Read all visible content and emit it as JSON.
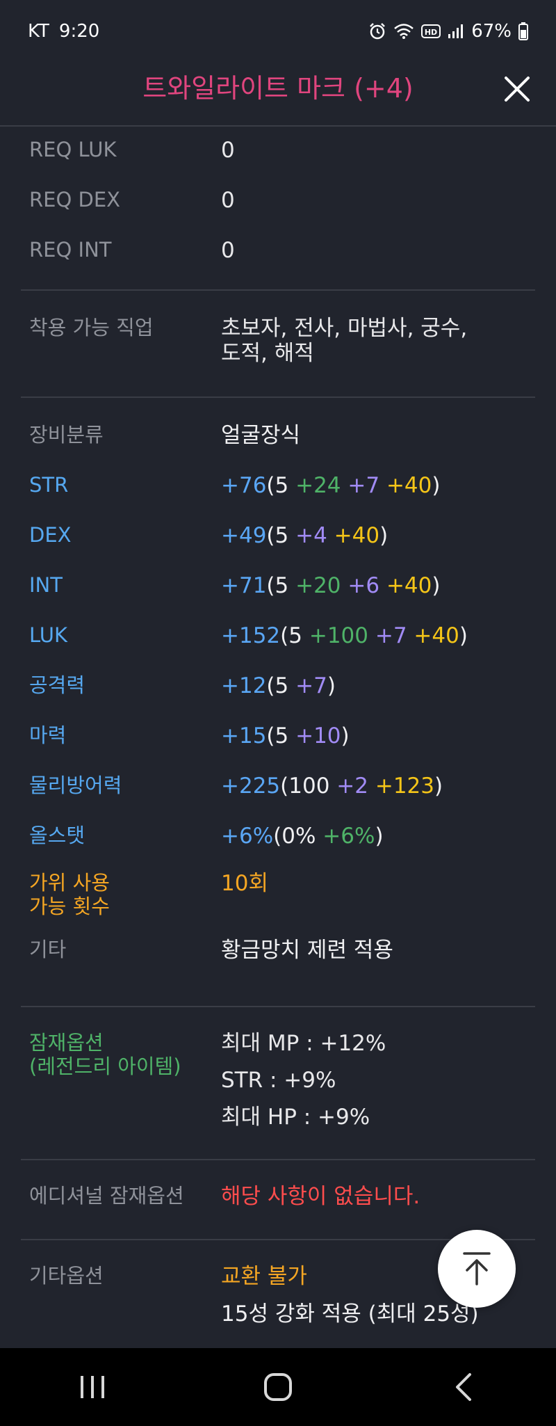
{
  "status_bar": {
    "carrier": "KT",
    "time": "9:20",
    "battery": "67%",
    "icons": [
      "alarm-icon",
      "wifi-icon",
      "hd-icon",
      "signal-icon",
      "battery-icon"
    ]
  },
  "header": {
    "title": "트와일라이트 마크 (+4)",
    "close_icon": "close-icon"
  },
  "requirements": [
    {
      "label": "REQ LUK",
      "value": "0"
    },
    {
      "label": "REQ DEX",
      "value": "0"
    },
    {
      "label": "REQ INT",
      "value": "0"
    }
  ],
  "jobs": {
    "label": "착용 가능 직업",
    "line1": "초보자, 전사, 마법사, 궁수,",
    "line2": "도적, 해적"
  },
  "category": {
    "label": "장비분류",
    "value": "얼굴장식"
  },
  "stats": [
    {
      "label": "STR",
      "total": "+76",
      "open": "(5",
      "parts": [
        {
          "text": " +24",
          "color": "green"
        },
        {
          "text": " +7",
          "color": "purple"
        },
        {
          "text": " +40",
          "color": "yellow"
        }
      ],
      "close": ")"
    },
    {
      "label": "DEX",
      "total": "+49",
      "open": "(5",
      "parts": [
        {
          "text": " +4",
          "color": "purple"
        },
        {
          "text": " +40",
          "color": "yellow"
        }
      ],
      "close": ")"
    },
    {
      "label": "INT",
      "total": "+71",
      "open": "(5",
      "parts": [
        {
          "text": " +20",
          "color": "green"
        },
        {
          "text": " +6",
          "color": "purple"
        },
        {
          "text": " +40",
          "color": "yellow"
        }
      ],
      "close": ")"
    },
    {
      "label": "LUK",
      "total": "+152",
      "open": "(5",
      "parts": [
        {
          "text": " +100",
          "color": "green"
        },
        {
          "text": " +7",
          "color": "purple"
        },
        {
          "text": " +40",
          "color": "yellow"
        }
      ],
      "close": ")"
    },
    {
      "label": "공격력",
      "total": "+12",
      "open": "(5",
      "parts": [
        {
          "text": " +7",
          "color": "purple"
        }
      ],
      "close": ")"
    },
    {
      "label": "마력",
      "total": "+15",
      "open": "(5",
      "parts": [
        {
          "text": " +10",
          "color": "purple"
        }
      ],
      "close": ")"
    },
    {
      "label": "물리방어력",
      "total": "+225",
      "open": "(100",
      "parts": [
        {
          "text": " +2",
          "color": "purple"
        },
        {
          "text": " +123",
          "color": "yellow"
        }
      ],
      "close": ")"
    },
    {
      "label": "올스탯",
      "total": "+6%",
      "open": "(0%",
      "parts": [
        {
          "text": " +6%",
          "color": "green"
        }
      ],
      "close": ")"
    }
  ],
  "scissors": {
    "label_line1": "가위 사용",
    "label_line2": "가능 횟수",
    "value": "10회"
  },
  "etc": {
    "label": "기타",
    "value": "황금망치 제련 적용"
  },
  "potential": {
    "label_line1": "잠재옵션",
    "label_line2": "(레전드리 아이템)",
    "lines": [
      "최대 MP : +12%",
      "STR : +9%",
      "최대 HP : +9%"
    ]
  },
  "additional_potential": {
    "label": "에디셔널 잠재옵션",
    "value": "해당 사항이 없습니다."
  },
  "other_options": {
    "label": "기타옵션",
    "line1": "교환 불가",
    "line2": "15성 강화 적용 (최대 25성)"
  },
  "colors": {
    "title": "#e0457e",
    "blue": "#5aa6f4",
    "green": "#4fb368",
    "purple": "#a18bf5",
    "yellow": "#f5c518",
    "orange": "#f5a623",
    "red": "#ff4d4d",
    "background": "#21242d"
  },
  "fab": {
    "icon": "arrow-up-icon"
  },
  "navbar": {
    "icons": [
      "recent-apps-icon",
      "home-icon",
      "back-icon"
    ]
  }
}
